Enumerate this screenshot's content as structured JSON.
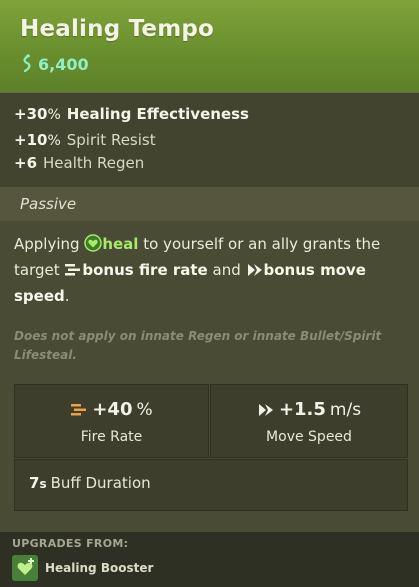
{
  "item": {
    "title": "Healing Tempo",
    "price": "6,400",
    "colors": {
      "header": "#6a8f2e",
      "price": "#8ff0c8",
      "heal": "#a6ea6a"
    }
  },
  "stats": [
    {
      "value": "+30",
      "suffix": "%",
      "label": "Healing Effectiveness",
      "label_bold": true
    },
    {
      "value": "+10",
      "suffix": "%",
      "label": "Spirit Resist",
      "label_bold": false
    },
    {
      "value": "+6",
      "suffix": "",
      "label": "Health Regen",
      "label_bold": false
    }
  ],
  "passive": {
    "label": "Passive",
    "desc": {
      "t1": "Applying",
      "heal_word": "heal",
      "t2": "to yourself or an ally grants the target",
      "fire_rate": "bonus fire rate",
      "t3": "and",
      "move_speed": "bonus move speed",
      "t4": "."
    },
    "note": "Does not apply on innate Regen or innate Bullet/Spirit Lifesteal."
  },
  "boxes": {
    "fire_rate": {
      "value": "+40",
      "unit": "%",
      "label": "Fire Rate",
      "icon": "fire-rate-icon"
    },
    "move_speed": {
      "value": "+1.5",
      "unit": "m/s",
      "label": "Move Speed",
      "icon": "move-speed-icon"
    },
    "duration": {
      "value": "7",
      "unit": "s",
      "label": "Buff Duration"
    }
  },
  "upgrades": {
    "header": "UPGRADES FROM:",
    "items": [
      {
        "name": "Healing Booster",
        "icon": "healing-booster-icon"
      }
    ]
  }
}
